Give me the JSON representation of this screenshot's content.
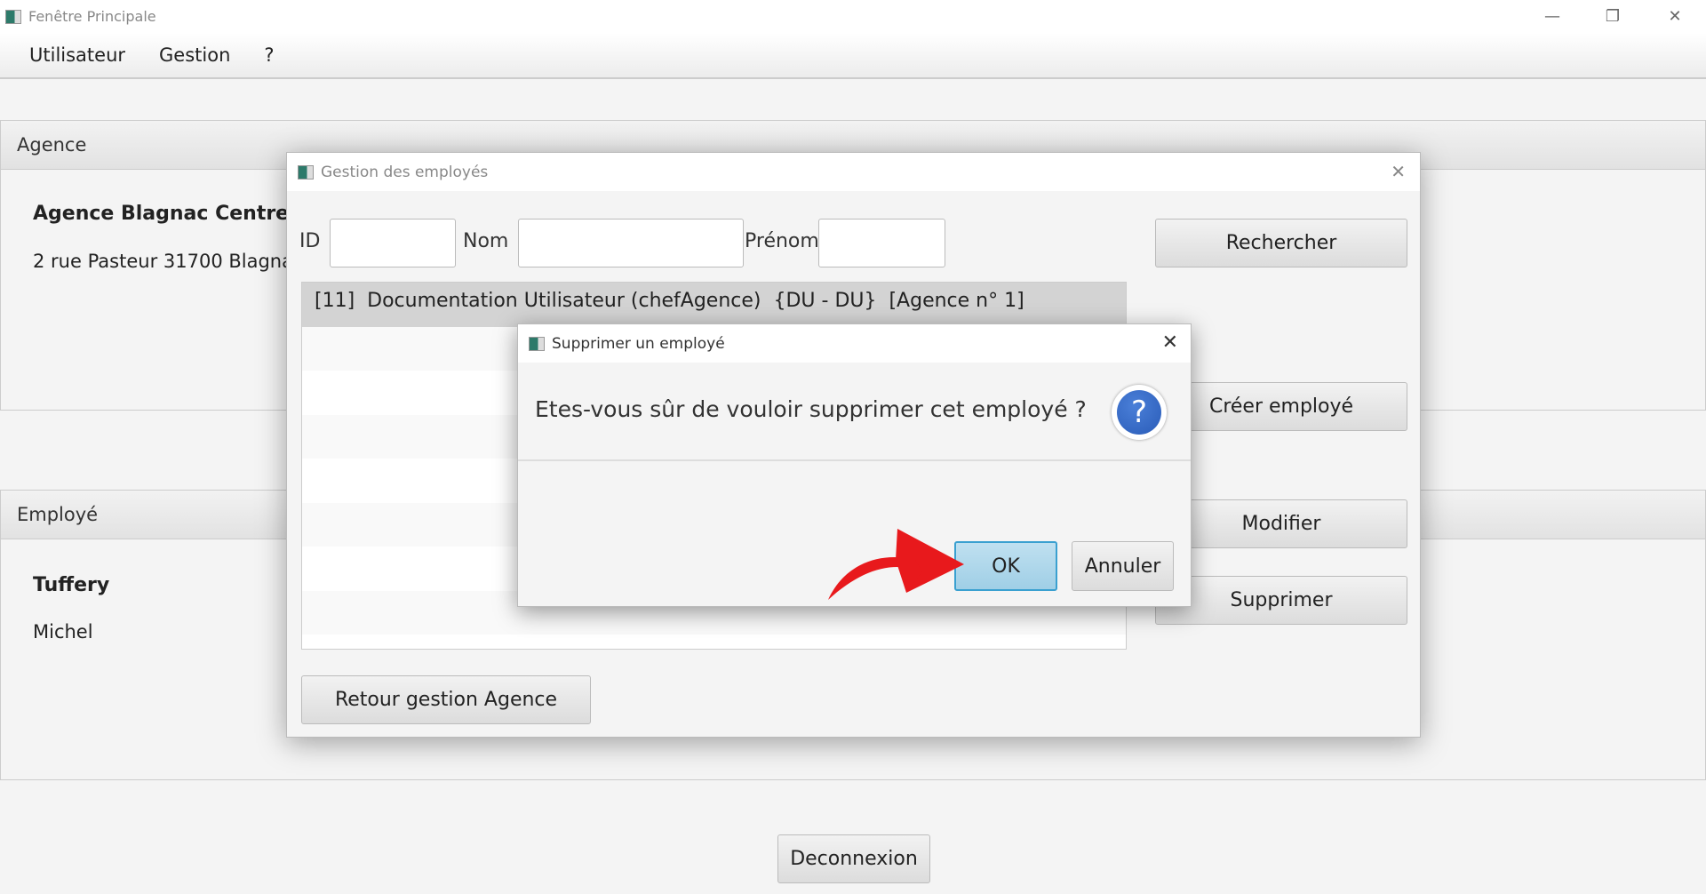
{
  "window": {
    "title": "Fenêtre Principale"
  },
  "menu": [
    "Utilisateur",
    "Gestion",
    "?"
  ],
  "agence": {
    "header": "Agence",
    "name": "Agence Blagnac Centre",
    "address": "2 rue Pasteur 31700 Blagnac"
  },
  "employe": {
    "header": "Employé",
    "nom": "Tuffery",
    "prenom": "Michel"
  },
  "logout_label": "Deconnexion",
  "gestion": {
    "title": "Gestion des employés",
    "id_label": "ID",
    "nom_label": "Nom",
    "prenom_label": "Prénom",
    "id_value": "",
    "nom_value": "",
    "prenom_value": "",
    "search_label": "Rechercher",
    "create_label": "Créer employé",
    "edit_label": "Modifier",
    "delete_label": "Supprimer",
    "back_label": "Retour gestion Agence",
    "list": [
      "[11]  Documentation Utilisateur (chefAgence)  {DU - DU}  [Agence n° 1]"
    ]
  },
  "confirm": {
    "title": "Supprimer un employé",
    "message": "Etes-vous sûr de vouloir supprimer cet employé ?",
    "ok_label": "OK",
    "cancel_label": "Annuler",
    "icon": "question-icon"
  },
  "colors": {
    "ok_button": "#a8d4ea",
    "question_icon": "#2a5cb8",
    "annotation_arrow": "#e8191c"
  }
}
